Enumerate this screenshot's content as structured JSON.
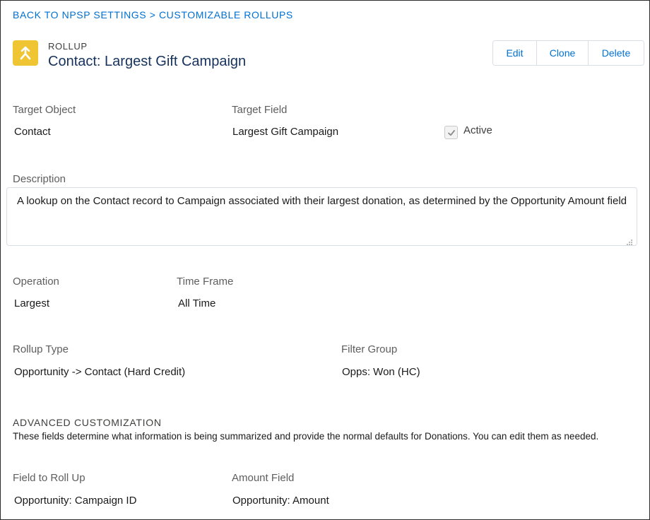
{
  "breadcrumb": "BACK TO NPSP SETTINGS > CUSTOMIZABLE ROLLUPS",
  "header": {
    "eyebrow": "ROLLUP",
    "title": "Contact: Largest Gift Campaign",
    "icon": "rollup-icon",
    "icon_color": "#f0c534"
  },
  "actions": {
    "edit": "Edit",
    "clone": "Clone",
    "delete": "Delete"
  },
  "fields": {
    "target_object_label": "Target Object",
    "target_object_value": "Contact",
    "target_field_label": "Target Field",
    "target_field_value": "Largest Gift Campaign",
    "active_label": "Active",
    "active_checked": true,
    "description_label": "Description",
    "description_value": "A lookup on the Contact record to Campaign associated with their largest donation, as determined by the Opportunity Amount field",
    "operation_label": "Operation",
    "operation_value": "Largest",
    "time_frame_label": "Time Frame",
    "time_frame_value": "All Time",
    "rollup_type_label": "Rollup Type",
    "rollup_type_value": "Opportunity -> Contact (Hard Credit)",
    "filter_group_label": "Filter Group",
    "filter_group_value": "Opps: Won (HC)"
  },
  "advanced": {
    "title": "ADVANCED CUSTOMIZATION",
    "help": "These fields determine what information is being summarized and provide the normal defaults for Donations. You can edit them as needed.",
    "field_to_roll_up_label": "Field to Roll Up",
    "field_to_roll_up_value": "Opportunity: Campaign ID",
    "amount_field_label": "Amount Field",
    "amount_field_value": "Opportunity: Amount"
  },
  "colors": {
    "link": "#0070d2",
    "border": "#d8dde6"
  }
}
